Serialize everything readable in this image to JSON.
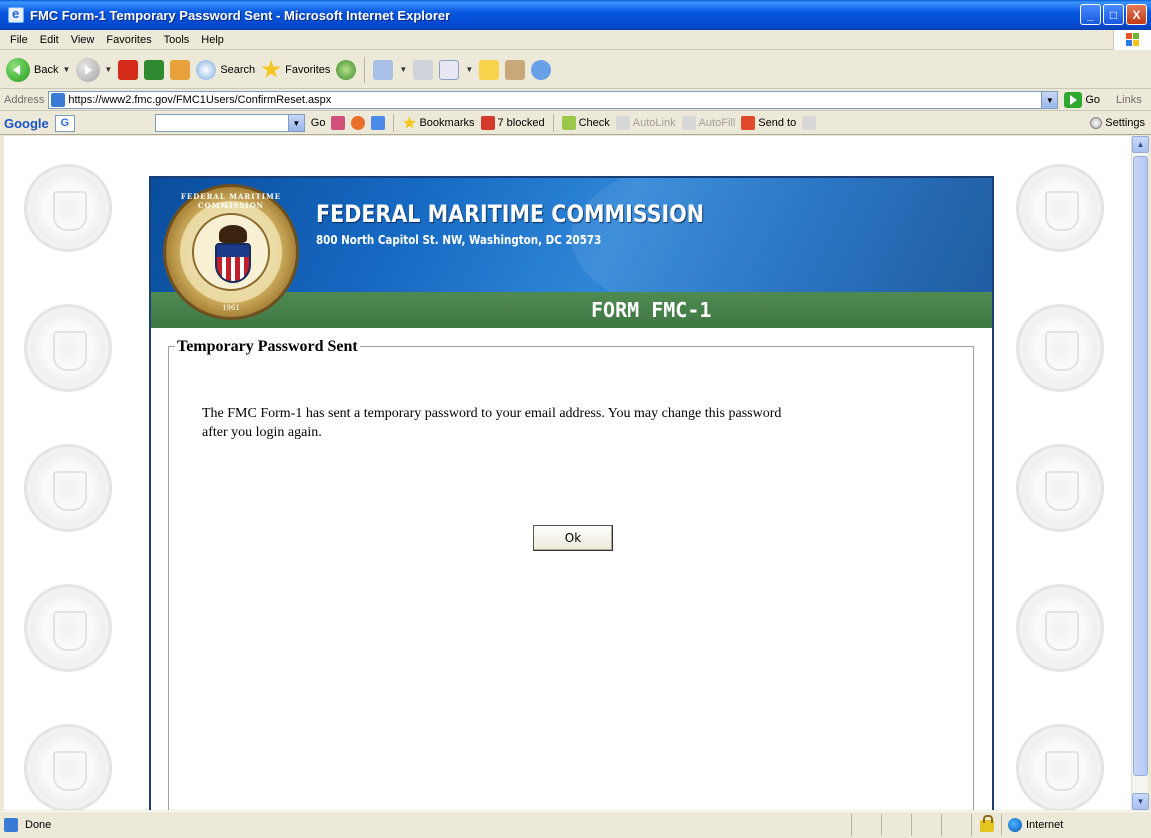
{
  "window": {
    "title": "FMC Form-1 Temporary Password Sent - Microsoft Internet Explorer",
    "minimize": "_",
    "maximize": "□",
    "close": "X"
  },
  "menubar": {
    "items": [
      "File",
      "Edit",
      "View",
      "Favorites",
      "Tools",
      "Help"
    ]
  },
  "toolbar": {
    "back_label": "Back",
    "search_label": "Search",
    "favorites_label": "Favorites"
  },
  "addressbar": {
    "label": "Address",
    "url": "https://www2.fmc.gov/FMC1Users/ConfirmReset.aspx",
    "go_label": "Go",
    "links_label": "Links"
  },
  "googlebar": {
    "logo": "Google",
    "go_label": "Go",
    "bookmarks_label": "Bookmarks",
    "blocked_label": "7 blocked",
    "check_label": "Check",
    "autolink_label": "AutoLink",
    "autofill_label": "AutoFill",
    "sendto_label": "Send to",
    "settings_label": "Settings"
  },
  "page": {
    "agency_name": "FEDERAL MARITIME COMMISSION",
    "agency_address": "800 North Capitol St. NW, Washington, DC 20573",
    "seal_text": "FEDERAL MARITIME COMMISSION",
    "seal_year": "1961",
    "form_title": "FORM FMC-1",
    "section_title": "Temporary Password Sent",
    "message": "The FMC Form-1 has sent a temporary password to your email address. You may change this password after you login again.",
    "ok_label": "Ok"
  },
  "statusbar": {
    "status": "Done",
    "zone": "Internet"
  },
  "colors": {
    "header_blue": "#1669c2",
    "form_band_green": "#4f8a52",
    "xp_titlebar": "#0858e0"
  }
}
